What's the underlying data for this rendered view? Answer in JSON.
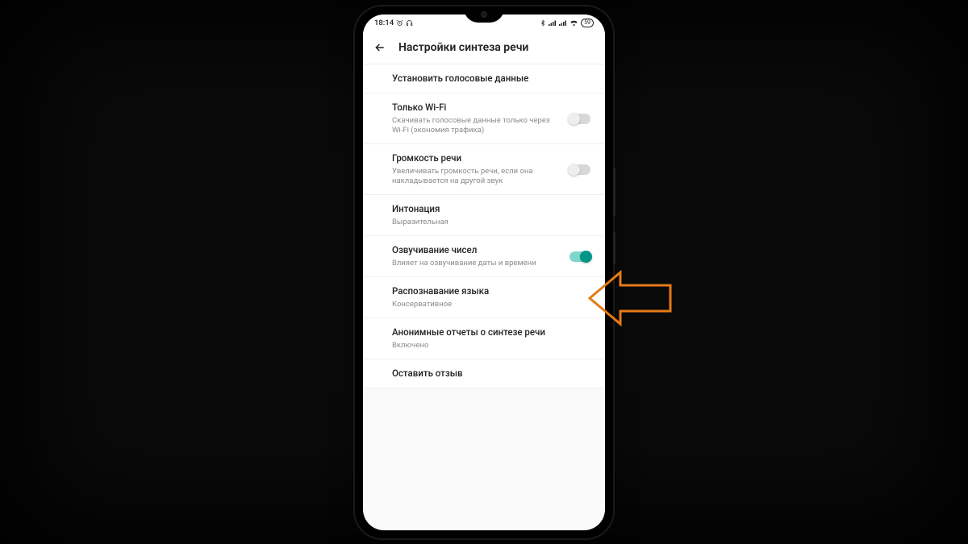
{
  "status": {
    "time": "18:14",
    "battery": "59"
  },
  "header": {
    "title": "Настройки синтеза речи"
  },
  "rows": {
    "install": {
      "title": "Установить голосовые данные"
    },
    "wifi": {
      "title": "Только Wi-Fi",
      "sub": "Скачивать голосовые данные только через Wi-Fi (экономия трафика)",
      "on": false
    },
    "volume": {
      "title": "Громкость речи",
      "sub": "Увеличивать громкость речи, если она накладывается на другой звук",
      "on": false
    },
    "intonation": {
      "title": "Интонация",
      "sub": "Выразительная"
    },
    "numbers": {
      "title": "Озвучивание чисел",
      "sub": "Влияет на озвучивание даты и времени",
      "on": true
    },
    "lang": {
      "title": "Распознавание языка",
      "sub": "Консервативное"
    },
    "reports": {
      "title": "Анонимные отчеты о синтезе речи",
      "sub": "Включено"
    },
    "feedback": {
      "title": "Оставить отзыв"
    }
  },
  "colors": {
    "accent": "#009688",
    "callout": "#e67a17"
  }
}
